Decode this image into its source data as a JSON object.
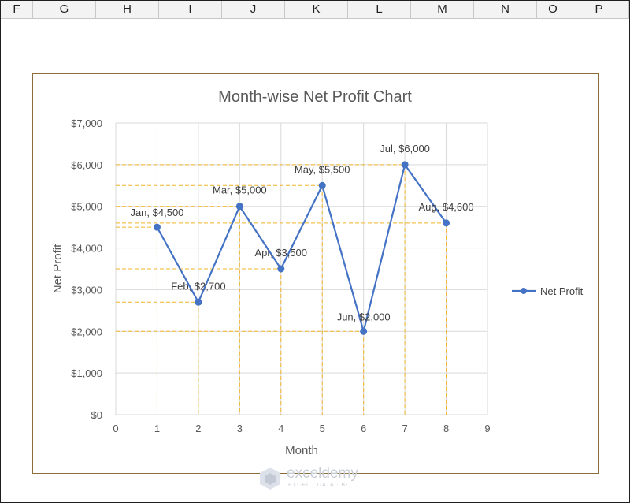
{
  "sheet": {
    "columns": [
      "F",
      "G",
      "H",
      "I",
      "J",
      "K",
      "L",
      "M",
      "N",
      "O",
      "P"
    ]
  },
  "chart_data": {
    "type": "line",
    "title": "Month-wise Net Profit Chart",
    "xlabel": "Month",
    "ylabel": "Net Profit",
    "xlim": [
      0,
      9
    ],
    "ylim": [
      0,
      7000
    ],
    "x_ticks": [
      "0",
      "1",
      "2",
      "3",
      "4",
      "5",
      "6",
      "7",
      "8",
      "9"
    ],
    "y_ticks": [
      "$0",
      "$1,000",
      "$2,000",
      "$3,000",
      "$4,000",
      "$5,000",
      "$6,000",
      "$7,000"
    ],
    "grid": true,
    "legend_position": "right",
    "series": [
      {
        "name": "Net Profit",
        "color": "#4472c4",
        "x": [
          1,
          2,
          3,
          4,
          5,
          6,
          7,
          8
        ],
        "values": [
          4500,
          2700,
          5000,
          3500,
          5500,
          2000,
          6000,
          4600
        ],
        "point_labels": [
          "Jan, $4,500",
          "Feb, $2,700",
          "Mar, $5,000",
          "Apr, $3,500",
          "May, $5,500",
          "Jun, $2,000",
          "Jul, $6,000",
          "Aug, $4,600"
        ]
      }
    ],
    "guide_line_color": "#f0b429"
  },
  "watermark": {
    "name": "exceldemy",
    "tagline": "EXCEL · DATA · BI"
  }
}
